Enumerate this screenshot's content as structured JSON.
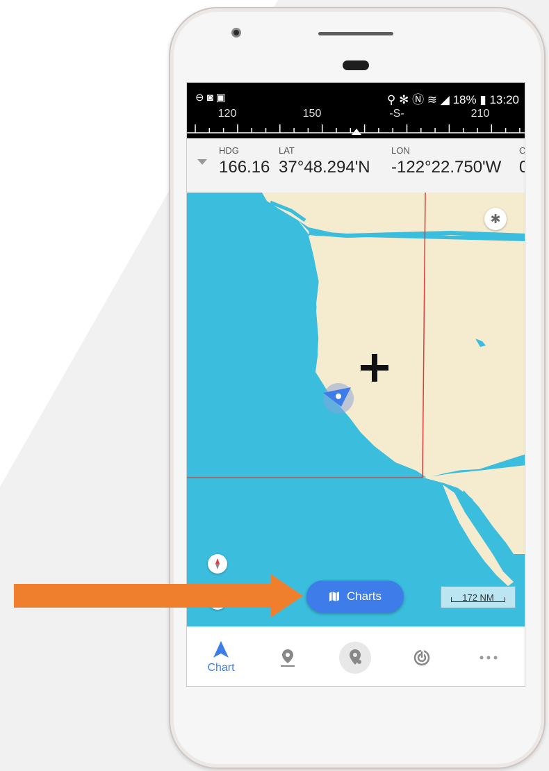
{
  "status_bar": {
    "left_icons": [
      "minus-circle-icon",
      "instagram-icon",
      "facebook-icon"
    ],
    "right_icons": [
      "location-pin-icon",
      "bluetooth-icon",
      "nfc-icon",
      "wifi-icon",
      "signal-icon"
    ],
    "battery": "18%",
    "time": "13:20"
  },
  "compass_strip": {
    "labels": [
      "120",
      "150",
      "-S-",
      "210"
    ]
  },
  "info_bar": {
    "hdg_label": "HDG",
    "hdg_value": "166.16",
    "lat_label": "LAT",
    "lat_value": "37°48.294'N",
    "lon_label": "LON",
    "lon_value": "-122°22.750'W",
    "cut_label": "C",
    "cut_value": "0"
  },
  "map": {
    "water_color": "#3bbede",
    "land_color": "#f5ebce",
    "boundary_color": "#e03a3a",
    "settings_icon": "gear-icon",
    "north_icon": "compass-north-icon",
    "crosshair_icon": "crosshair-plus-icon",
    "vessel_icon": "vessel-heading-icon"
  },
  "charts_button": {
    "label": "Charts",
    "icon": "map-icon"
  },
  "scale_bar": {
    "label": "172 NM"
  },
  "tab_bar": {
    "active": "Chart",
    "tabs": [
      {
        "label": "Chart",
        "icon": "navigation-arrow-icon"
      },
      {
        "label": "",
        "icon": "waypoint-pin-icon"
      },
      {
        "label": "",
        "icon": "route-pin-icon"
      },
      {
        "label": "",
        "icon": "radar-icon"
      },
      {
        "label": "",
        "icon": "more-dots-icon"
      }
    ]
  },
  "annotation": {
    "arrow_color": "#ef7f2d"
  }
}
